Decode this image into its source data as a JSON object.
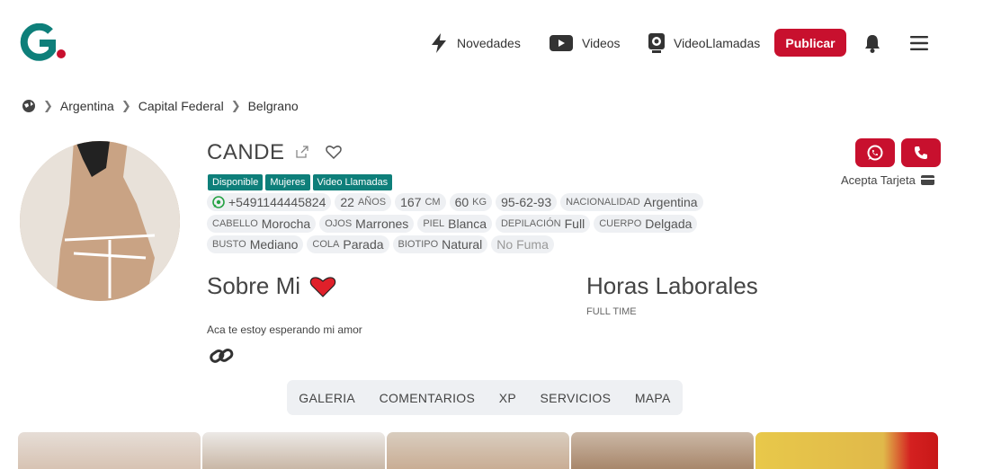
{
  "header": {
    "nav": [
      {
        "label": "Novedades",
        "icon": "lightning-icon"
      },
      {
        "label": "Videos",
        "icon": "youtube-icon"
      },
      {
        "label": "VideoLlamadas",
        "icon": "webcam-icon"
      }
    ],
    "publish_label": "Publicar",
    "accent_color": "#c8102e",
    "logo_color": "#0e7f7a"
  },
  "breadcrumb": [
    "Argentina",
    "Capital Federal",
    "Belgrano"
  ],
  "profile": {
    "name": "CANDE",
    "badges": [
      "Disponible",
      "Mujeres",
      "Video Llamadas"
    ],
    "row1": {
      "phone": "+5491144445824",
      "age_value": "22",
      "age_unit": "AÑOS",
      "height_value": "167",
      "height_unit": "CM",
      "weight_value": "60",
      "weight_unit": "KG",
      "measures": "95-62-93",
      "nationality_label": "NACIONALIDAD",
      "nationality": "Argentina"
    },
    "row2": {
      "hair_label": "CABELLO",
      "hair": "Morocha",
      "eyes_label": "OJOS",
      "eyes": "Marrones",
      "skin_label": "PIEL",
      "skin": "Blanca",
      "depil_label": "DEPILACIÓN",
      "depil": "Full",
      "body_label": "CUERPO",
      "body": "Delgada"
    },
    "row3": {
      "bust_label": "BUSTO",
      "bust": "Mediano",
      "cola_label": "COLA",
      "cola": "Parada",
      "bio_label": "BIOTIPO",
      "bio": "Natural",
      "smoke": "No Fuma"
    },
    "card_text": "Acepta Tarjeta"
  },
  "about": {
    "title": "Sobre Mi",
    "text": "Aca te estoy esperando mi amor"
  },
  "hours": {
    "title": "Horas Laborales",
    "value": "FULL TIME"
  },
  "tabs": [
    "GALERIA",
    "COMENTARIOS",
    "XP",
    "SERVICIOS",
    "MAPA"
  ]
}
